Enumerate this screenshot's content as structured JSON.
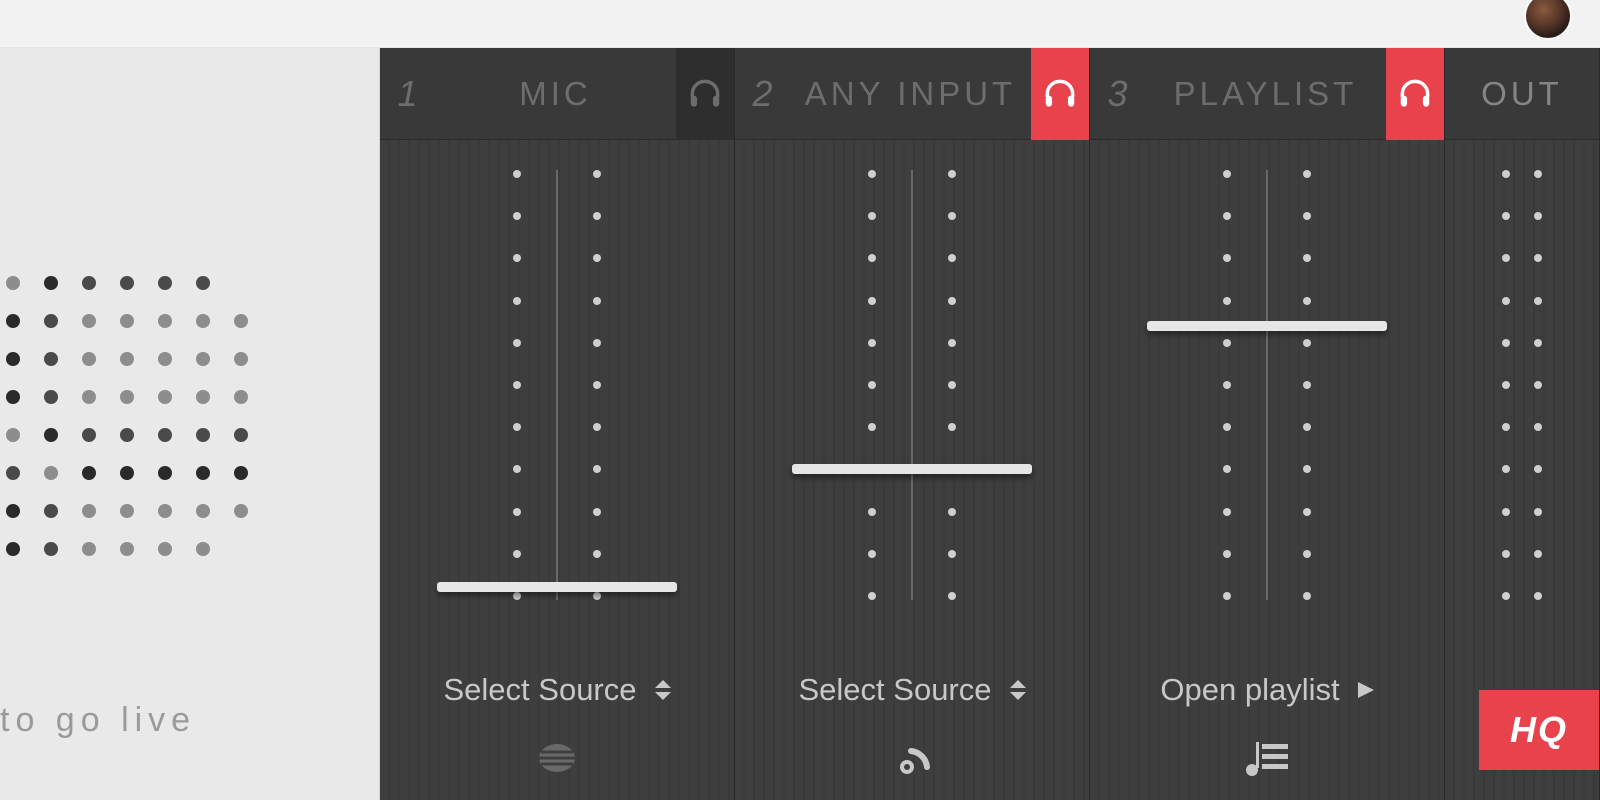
{
  "sidebar": {
    "go_live_text": "to go live"
  },
  "channels": [
    {
      "num": "1",
      "label": "MIC",
      "monitor_active": false,
      "source_label": "Select Source",
      "fader": 0.02,
      "footer_icon": "mic-grille"
    },
    {
      "num": "2",
      "label": "ANY INPUT",
      "monitor_active": true,
      "source_label": "Select Source",
      "fader": 0.3,
      "footer_icon": "stream"
    },
    {
      "num": "3",
      "label": "PLAYLIST",
      "monitor_active": true,
      "source_label": "Open playlist",
      "fader": 0.64,
      "footer_icon": "playlist"
    }
  ],
  "out": {
    "label": "OUT",
    "hq": "HQ"
  },
  "colors": {
    "accent": "#e8424c"
  }
}
